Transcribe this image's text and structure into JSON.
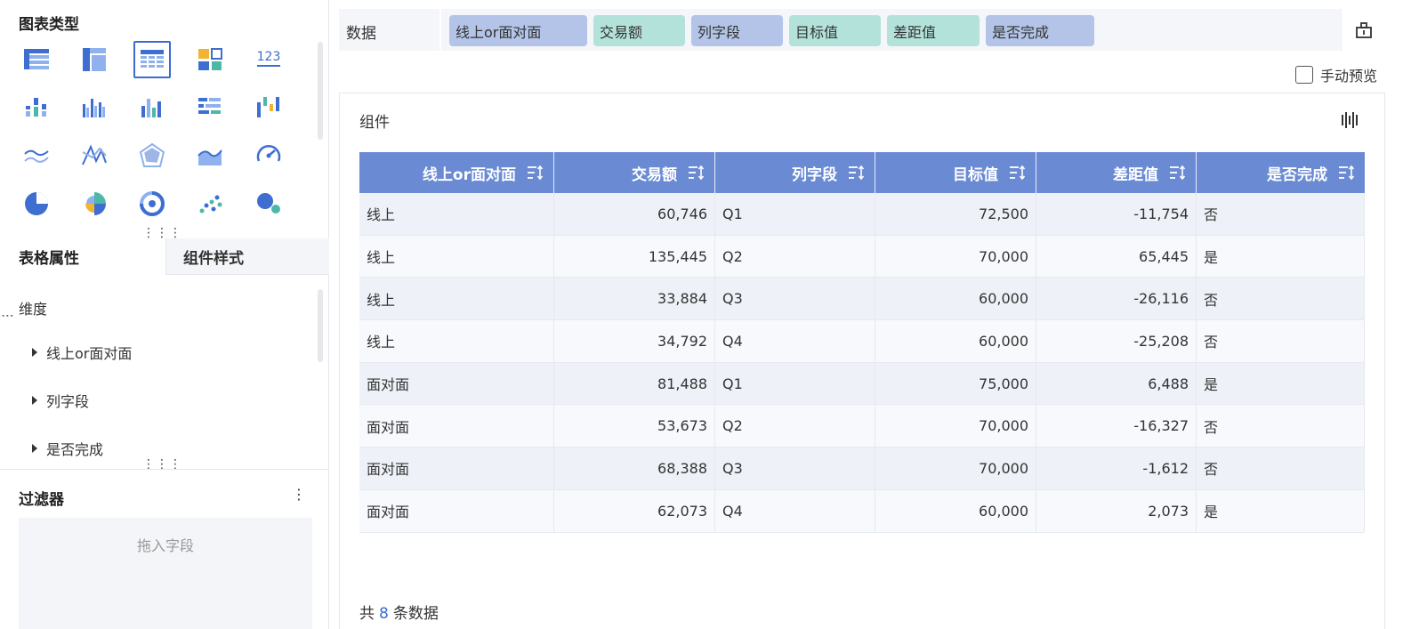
{
  "left_panel": {
    "chart_types_title": "图表类型",
    "chart_types": [
      {
        "icon": "table-icon",
        "selected": false
      },
      {
        "icon": "cross-table-icon",
        "selected": false
      },
      {
        "icon": "detail-table-icon",
        "selected": true
      },
      {
        "icon": "card-grid-icon",
        "selected": false
      },
      {
        "icon": "number-card-icon",
        "selected": false
      },
      {
        "icon": "stacked-bar-icon",
        "selected": false
      },
      {
        "icon": "grouped-column-icon",
        "selected": false
      },
      {
        "icon": "column-chart-icon",
        "selected": false
      },
      {
        "icon": "horizontal-bar-icon",
        "selected": false
      },
      {
        "icon": "waterfall-icon",
        "selected": false
      },
      {
        "icon": "line-chart-icon",
        "selected": false
      },
      {
        "icon": "multi-line-icon",
        "selected": false
      },
      {
        "icon": "radar-icon",
        "selected": false
      },
      {
        "icon": "area-chart-icon",
        "selected": false
      },
      {
        "icon": "gauge-icon",
        "selected": false
      },
      {
        "icon": "pie-chart-icon",
        "selected": false
      },
      {
        "icon": "rose-chart-icon",
        "selected": false
      },
      {
        "icon": "ring-chart-icon",
        "selected": false
      },
      {
        "icon": "scatter-icon",
        "selected": false
      },
      {
        "icon": "bubble-icon",
        "selected": false
      }
    ],
    "tabs": {
      "table_props": "表格属性",
      "component_style": "组件样式"
    },
    "dimension_label": "维度",
    "dimensions": [
      "线上or面对面",
      "列字段",
      "是否完成"
    ],
    "filter_title": "过滤器",
    "filter_more": "⋮",
    "drop_placeholder": "拖入字段",
    "grip": "⋮⋮⋮"
  },
  "data_bar": {
    "label": "数据",
    "fields": [
      {
        "label": "线上or面对面",
        "kind": "dimension"
      },
      {
        "label": "交易额",
        "kind": "measure"
      },
      {
        "label": "列字段",
        "kind": "dimension"
      },
      {
        "label": "目标值",
        "kind": "measure"
      },
      {
        "label": "差距值",
        "kind": "measure"
      },
      {
        "label": "是否完成",
        "kind": "dimension"
      }
    ]
  },
  "manual_preview": "手动预览",
  "card": {
    "title": "组件",
    "columns": [
      "线上or面对面",
      "交易额",
      "列字段",
      "目标值",
      "差距值",
      "是否完成"
    ],
    "rows": [
      [
        "线上",
        "60,746",
        "Q1",
        "72,500",
        "-11,754",
        "否"
      ],
      [
        "线上",
        "135,445",
        "Q2",
        "70,000",
        "65,445",
        "是"
      ],
      [
        "线上",
        "33,884",
        "Q3",
        "60,000",
        "-26,116",
        "否"
      ],
      [
        "线上",
        "34,792",
        "Q4",
        "60,000",
        "-25,208",
        "否"
      ],
      [
        "面对面",
        "81,488",
        "Q1",
        "75,000",
        "6,488",
        "是"
      ],
      [
        "面对面",
        "53,673",
        "Q2",
        "70,000",
        "-16,327",
        "否"
      ],
      [
        "面对面",
        "68,388",
        "Q3",
        "70,000",
        "-1,612",
        "否"
      ],
      [
        "面对面",
        "62,073",
        "Q4",
        "60,000",
        "2,073",
        "是"
      ]
    ],
    "total_prefix": "共",
    "total_count": "8",
    "total_suffix": "条数据"
  },
  "colors": {
    "header_bg": "#6a8bd4",
    "dimension_pill": "#b3c4e8",
    "measure_pill": "#b3e2da",
    "accent": "#3b6ccf"
  }
}
